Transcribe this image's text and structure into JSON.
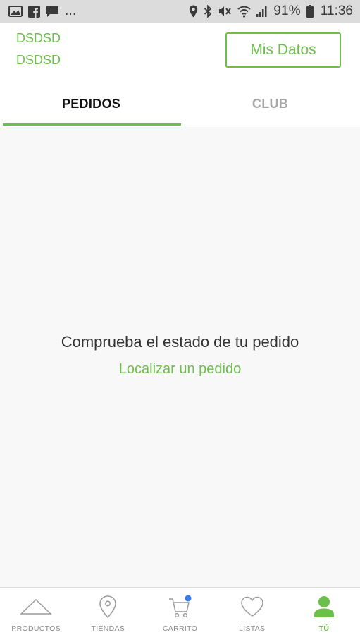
{
  "status_bar": {
    "left_icons": [
      "gallery-icon",
      "facebook-icon",
      "chat-icon"
    ],
    "overflow": "...",
    "right_icons": [
      "location-icon",
      "bluetooth-icon",
      "mute-icon",
      "wifi-icon",
      "signal-icon"
    ],
    "battery": "91%",
    "time": "11:36"
  },
  "header": {
    "user_line_1": "DSDSD",
    "user_line_2": "DSDSD",
    "mis_datos_label": "Mis Datos"
  },
  "tabs": [
    {
      "label": "PEDIDOS",
      "active": true
    },
    {
      "label": "CLUB",
      "active": false
    }
  ],
  "main": {
    "empty_message": "Comprueba el estado de tu pedido",
    "locate_link": "Localizar un pedido"
  },
  "bottom_nav": [
    {
      "label": "PRODUCTOS",
      "icon": "triangle-icon",
      "active": false
    },
    {
      "label": "TIENDAS",
      "icon": "map-pin-icon",
      "active": false
    },
    {
      "label": "CARRITO",
      "icon": "cart-icon",
      "active": false,
      "badge": true
    },
    {
      "label": "LISTAS",
      "icon": "heart-icon",
      "active": false
    },
    {
      "label": "TÚ",
      "icon": "user-icon",
      "active": true
    }
  ],
  "colors": {
    "accent": "#6cc04a",
    "badge": "#3b7df0",
    "status_bar": "#dcdcdc",
    "inactive_tab": "#a8a8a8"
  }
}
